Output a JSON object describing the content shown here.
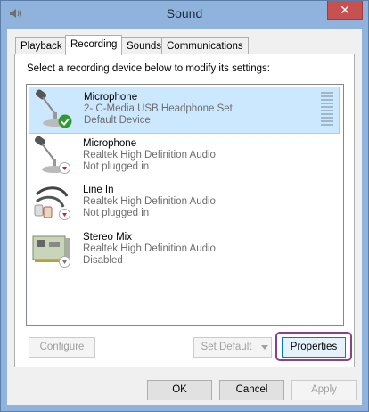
{
  "window": {
    "title": "Sound",
    "close_glyph": "✕"
  },
  "tabs": [
    {
      "label": "Playback",
      "active": false
    },
    {
      "label": "Recording",
      "active": true
    },
    {
      "label": "Sounds",
      "active": false
    },
    {
      "label": "Communications",
      "active": false
    }
  ],
  "recording": {
    "instruction": "Select a recording device below to modify its settings:",
    "devices": [
      {
        "name": "Microphone",
        "driver": "2- C-Media USB Headphone Set",
        "status": "Default Device",
        "icon": "microphone-icon",
        "badge": "green-check",
        "selected": true
      },
      {
        "name": "Microphone",
        "driver": "Realtek High Definition Audio",
        "status": "Not plugged in",
        "icon": "microphone-icon",
        "badge": "red-down-arrow",
        "selected": false
      },
      {
        "name": "Line In",
        "driver": "Realtek High Definition Audio",
        "status": "Not plugged in",
        "icon": "line-in-cable-icon",
        "badge": "red-down-arrow",
        "selected": false
      },
      {
        "name": "Stereo Mix",
        "driver": "Realtek High Definition Audio",
        "status": "Disabled",
        "icon": "sound-card-icon",
        "badge": "gray-down-arrow",
        "selected": false
      }
    ],
    "buttons": {
      "configure": "Configure",
      "set_default": "Set Default",
      "properties": "Properties"
    }
  },
  "footer": {
    "ok": "OK",
    "cancel": "Cancel",
    "apply": "Apply"
  },
  "colors": {
    "selection": "#cce8ff",
    "highlight_outline": "#8c3f8c",
    "title_bar": "#8fb3dc",
    "close_button": "#c75050"
  }
}
